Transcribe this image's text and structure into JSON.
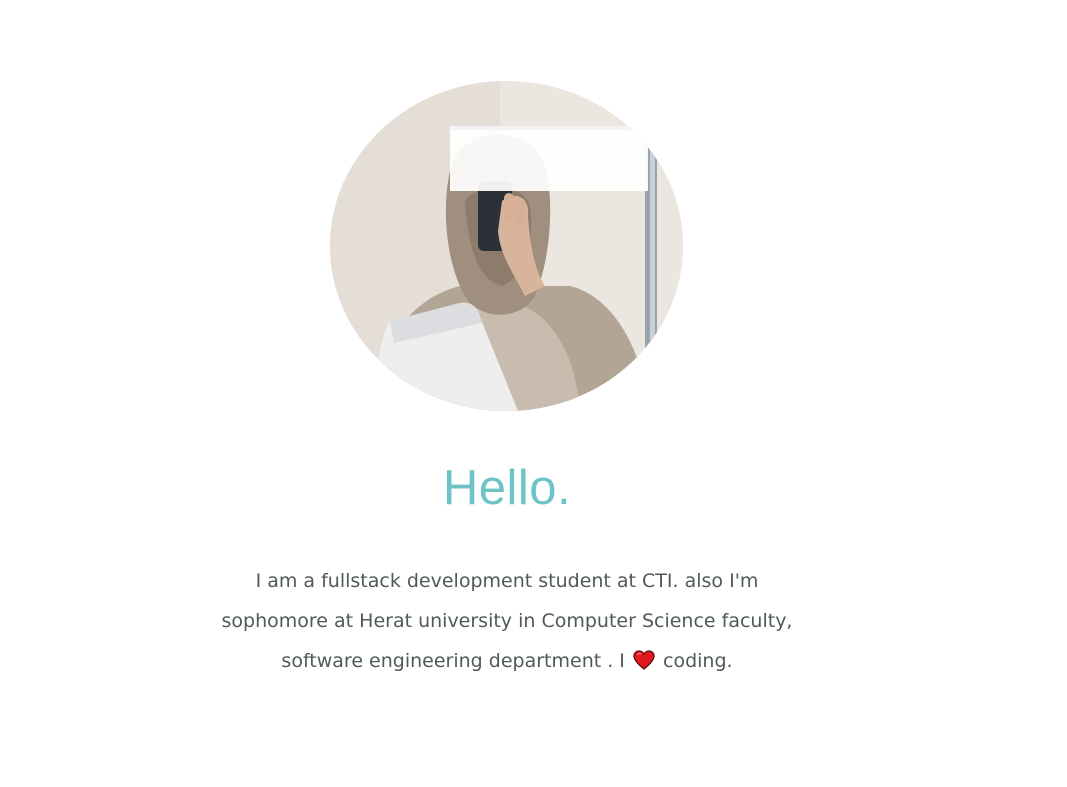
{
  "profile": {
    "image_alt": "profile photo"
  },
  "greeting": {
    "title": "Hello."
  },
  "bio": {
    "line1": "I am a fullstack development student at CTI. also I'm",
    "line2": "sophomore at Herat university in Computer Science faculty,",
    "line3_before": "software engineering department . I",
    "line3_after": "coding.",
    "emoji_icon": "heart-icon"
  },
  "colors": {
    "heading": "#6cc4c7",
    "text": "#50595a",
    "heart": "#e1181f"
  }
}
